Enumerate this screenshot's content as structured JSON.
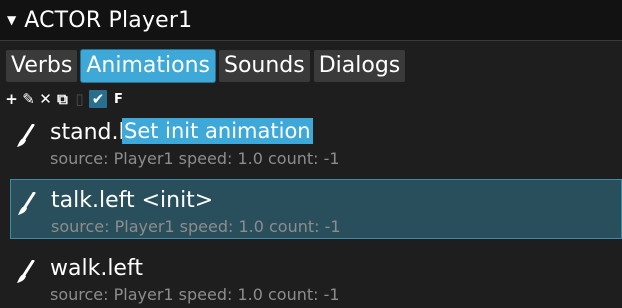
{
  "header": {
    "title": "ACTOR Player1"
  },
  "tabs": [
    {
      "label": "Verbs"
    },
    {
      "label": "Animations"
    },
    {
      "label": "Sounds"
    },
    {
      "label": "Dialogs"
    }
  ],
  "toolbar": {
    "add": "+",
    "edit": "✎",
    "delete": "✕",
    "copy": "⧉",
    "paste": "▯",
    "check": "✔",
    "flip": "F"
  },
  "tooltip": {
    "text": "Set init animation"
  },
  "animations": [
    {
      "name": "stand.left",
      "meta": "source: Player1 speed: 1.0 count: -1"
    },
    {
      "name": "talk.left <init>",
      "meta": "source: Player1 speed: 1.0 count: -1"
    },
    {
      "name": "walk.left",
      "meta": "source: Player1 speed: 1.0 count: -1"
    }
  ],
  "colors": {
    "accent": "#3ea9d9",
    "selected_bg": "#2a4f5c",
    "background": "#1e1e1e"
  }
}
